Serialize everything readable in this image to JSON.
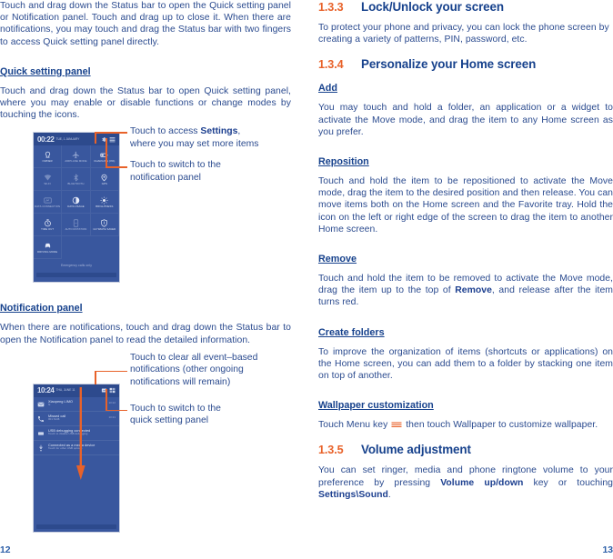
{
  "document": {
    "left_page_number": "12",
    "right_page_number": "13"
  },
  "colors": {
    "accent_orange": "#e8622a",
    "heading_blue": "#16418c",
    "body_blue": "#2b4b8f",
    "phone_bg": "#39579e",
    "phone_statusbar": "#2d4a8d"
  },
  "left_column": {
    "intro_paragraph": "Touch and drag down the Status bar to open the Quick setting panel or Notification panel. Touch and drag up to close it. When there are notifications, you may touch and drag the Status bar with two fingers to access Quick setting panel directly.",
    "quick_setting_heading": "Quick setting panel",
    "quick_setting_paragraph": "Touch and drag down the Status bar to open Quick setting panel, where you may enable or disable functions or change modes by touching the icons.",
    "notification_heading": "Notification panel",
    "notification_paragraph": "When there are notifications, touch and drag down the Status bar to open the Notification panel to read the detailed information.",
    "callouts": {
      "settings_line1": "Touch to access ",
      "settings_bold": "Settings",
      "settings_line1_tail": ",",
      "settings_line2": "where you may set more items",
      "switch_notif_line1": "Touch to switch to the",
      "switch_notif_line2": "notification panel",
      "clear_line1": "Touch to clear all event–based",
      "clear_line2": "notifications (other ongoing",
      "clear_line3": "notifications will remain)",
      "switch_quick_line1": "Touch to switch to the",
      "switch_quick_line2": "quick setting panel"
    }
  },
  "quick_setting_panel": {
    "status_bar": {
      "time": "00:22",
      "date": "TUE, 1 JANUARY",
      "icons": [
        "gear-icon",
        "list-icon"
      ]
    },
    "tiles": [
      {
        "label": "OWNER",
        "icon": "owner-icon",
        "active": true
      },
      {
        "label": "AIRPLANE MODE",
        "icon": "airplane-icon",
        "active": false
      },
      {
        "label": "CHARGING (0%)",
        "icon": "battery-icon",
        "active": true
      },
      {
        "label": "WI-FI",
        "icon": "wifi-icon",
        "active": false
      },
      {
        "label": "BLUETOOTH",
        "icon": "bluetooth-icon",
        "active": false
      },
      {
        "label": "GPS",
        "icon": "gps-icon",
        "active": true
      },
      {
        "label": "DATA CONNECTION",
        "icon": "data-connection-icon",
        "active": false
      },
      {
        "label": "DATA USAGE",
        "icon": "data-usage-icon",
        "active": true
      },
      {
        "label": "BRIGHTNESS",
        "icon": "brightness-icon",
        "active": true
      },
      {
        "label": "TIME OUT",
        "icon": "timeout-icon",
        "active": true
      },
      {
        "label": "AUTO ROTATION",
        "icon": "auto-rotation-icon",
        "active": false
      },
      {
        "label": "ULTIMATE SAVER",
        "icon": "ultimate-saver-icon",
        "active": true
      },
      {
        "label": "DRIVING MODE",
        "icon": "driving-mode-icon",
        "active": true
      }
    ],
    "footer_text": "Emergency calls only"
  },
  "notification_panel": {
    "status_bar": {
      "time": "10:24",
      "date": "THU, JUNE 11",
      "icons": [
        "clear-all-icon",
        "quick-settings-icon"
      ]
    },
    "notifications": [
      {
        "icon": "message-icon",
        "title": "Xiaopeng LIMO",
        "subtitle": "hi",
        "time": "10:22"
      },
      {
        "icon": "missed-call-icon",
        "title": "Missed call",
        "subtitle": "001 6146",
        "time": "10:21"
      },
      {
        "icon": "usb-icon",
        "title": "USB debugging connected",
        "subtitle": "Touch to disable USB debugging",
        "time": ""
      },
      {
        "icon": "usb-plug-icon",
        "title": "Connected as a media device",
        "subtitle": "Touch for other USB options",
        "time": ""
      }
    ]
  },
  "right_column": {
    "section_133": {
      "number": "1.3.3",
      "title": "Lock/Unlock your screen",
      "paragraph": "To protect your phone and privacy, you can lock the phone screen by creating a variety of patterns, PIN, password, etc."
    },
    "section_134": {
      "number": "1.3.4",
      "title": "Personalize your Home screen",
      "add_heading": "Add",
      "add_paragraph": "You may touch and hold a folder, an application or a widget to activate the Move mode, and drag the item to any Home screen as you prefer.",
      "reposition_heading": "Reposition",
      "reposition_paragraph": "Touch and hold the item to be repositioned to activate the Move mode, drag the item to the desired position and then release. You can move items both on the Home screen and the Favorite tray. Hold the icon on the left or right edge of the screen to drag the item to another Home screen.",
      "remove_heading": "Remove",
      "remove_paragraph_a": "Touch and hold the item to be removed to activate the Move mode, drag the item up to the top of ",
      "remove_bold": "Remove",
      "remove_paragraph_b": ", and release after the item turns red.",
      "folders_heading": "Create folders",
      "folders_paragraph": "To improve the organization of items (shortcuts or applications) on the Home screen, you can add them to a folder by stacking one item on top of another.",
      "wallpaper_heading": "Wallpaper customization",
      "wallpaper_paragraph_a": "Touch Menu key ",
      "wallpaper_paragraph_b": " then touch Wallpaper to customize wallpaper."
    },
    "section_135": {
      "number": "1.3.5",
      "title": "Volume adjustment",
      "paragraph_a": "You can set ringer, media and phone ringtone volume to your preference by pressing ",
      "bold_1": "Volume up/down",
      "paragraph_b": " key or touching ",
      "bold_2": "Settings\\",
      "bold_3": "Sound",
      "paragraph_c": "."
    }
  }
}
